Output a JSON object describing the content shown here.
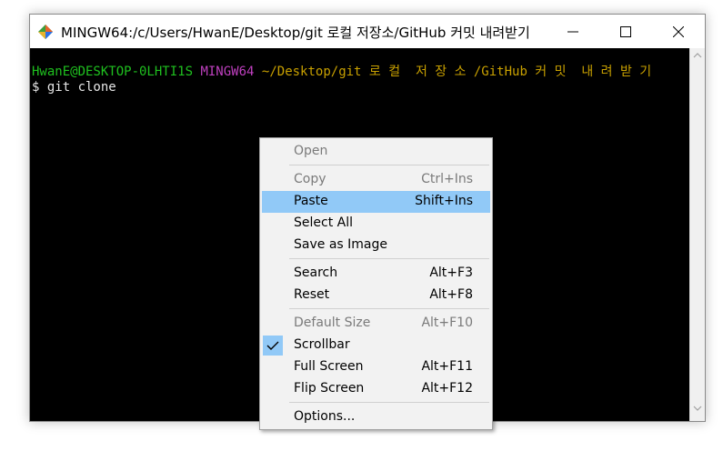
{
  "window": {
    "title": "MINGW64:/c/Users/HwanE/Desktop/git 로컬 저장소/GitHub 커밋 내려받기",
    "app_icon": "git-diamond-icon",
    "controls": {
      "minimize": "minimize-icon",
      "maximize": "maximize-icon",
      "close": "close-icon"
    }
  },
  "terminal": {
    "prompt_user_host": "HwanE@DESKTOP-0LHTI1S",
    "prompt_env": "MINGW64",
    "prompt_path": "~/Desktop/git 로 컬  저 장 소 /GitHub 커 밋  내 려 받 기",
    "command_line": "$ git clone"
  },
  "context_menu": {
    "items": [
      {
        "label": "Open",
        "shortcut": "",
        "enabled": false,
        "highlighted": false,
        "checked": false
      },
      {
        "label": "Copy",
        "shortcut": "Ctrl+Ins",
        "enabled": false,
        "highlighted": false,
        "checked": false
      },
      {
        "label": "Paste",
        "shortcut": "Shift+Ins",
        "enabled": true,
        "highlighted": true,
        "checked": false
      },
      {
        "label": "Select All",
        "shortcut": "",
        "enabled": true,
        "highlighted": false,
        "checked": false
      },
      {
        "label": "Save as Image",
        "shortcut": "",
        "enabled": true,
        "highlighted": false,
        "checked": false
      },
      {
        "label": "Search",
        "shortcut": "Alt+F3",
        "enabled": true,
        "highlighted": false,
        "checked": false
      },
      {
        "label": "Reset",
        "shortcut": "Alt+F8",
        "enabled": true,
        "highlighted": false,
        "checked": false
      },
      {
        "label": "Default Size",
        "shortcut": "Alt+F10",
        "enabled": false,
        "highlighted": false,
        "checked": false
      },
      {
        "label": "Scrollbar",
        "shortcut": "",
        "enabled": true,
        "highlighted": false,
        "checked": true
      },
      {
        "label": "Full Screen",
        "shortcut": "Alt+F11",
        "enabled": true,
        "highlighted": false,
        "checked": false
      },
      {
        "label": "Flip Screen",
        "shortcut": "Alt+F12",
        "enabled": true,
        "highlighted": false,
        "checked": false
      },
      {
        "label": "Options...",
        "shortcut": "",
        "enabled": true,
        "highlighted": false,
        "checked": false
      }
    ]
  },
  "colors": {
    "prompt_green": "#1fc01f",
    "prompt_purple": "#bf40bf",
    "prompt_yellow": "#c8a000",
    "menu_highlight": "#91c9f7"
  }
}
